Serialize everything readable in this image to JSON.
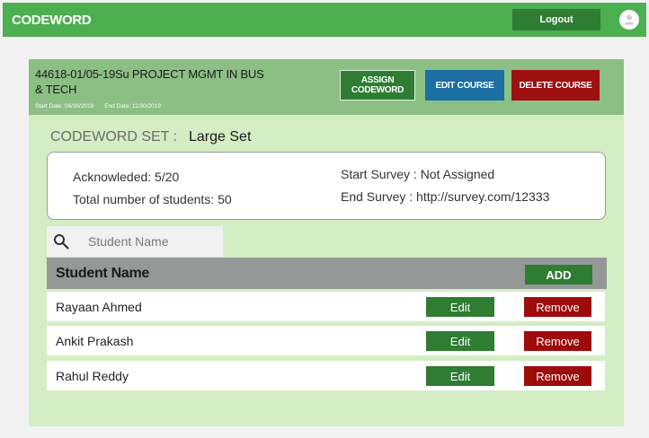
{
  "app": {
    "title": "CODEWORD",
    "logout_label": "Logout",
    "avatar_icon": "user-icon"
  },
  "course": {
    "title": "44618-01/05-19Su PROJECT MGMT IN BUS & TECH",
    "start_date": "Start Date: 06/30/2019",
    "end_date": "End Date: 11/30/2019",
    "assign_label": "ASSIGN CODEWORD",
    "edit_label": "EDIT COURSE",
    "delete_label": "DELETE COURSE"
  },
  "codeword_set": {
    "label": "CODEWORD SET :",
    "value": "Large Set"
  },
  "stats": {
    "acknowledged": "Acknowleded: 5/20",
    "total_students": "Total number of students: 50",
    "start_survey": "Start Survey : Not Assigned",
    "end_survey": "End Survey : http://survey.com/12333"
  },
  "search": {
    "placeholder": "Student Name",
    "icon": "search-icon"
  },
  "table": {
    "column_header": "Student Name",
    "add_label": "ADD",
    "edit_label": "Edit",
    "remove_label": "Remove",
    "rows": [
      {
        "name": "Rayaan Ahmed"
      },
      {
        "name": "Ankit Prakash"
      },
      {
        "name": "Rahul Reddy"
      }
    ]
  },
  "colors": {
    "topbar": "#4caf50",
    "primary_green": "#2e7d32",
    "card_bg": "#d4edc4",
    "card_header": "#8cbf84",
    "edit_blue": "#1b6fa3",
    "danger_red": "#9e1010"
  }
}
